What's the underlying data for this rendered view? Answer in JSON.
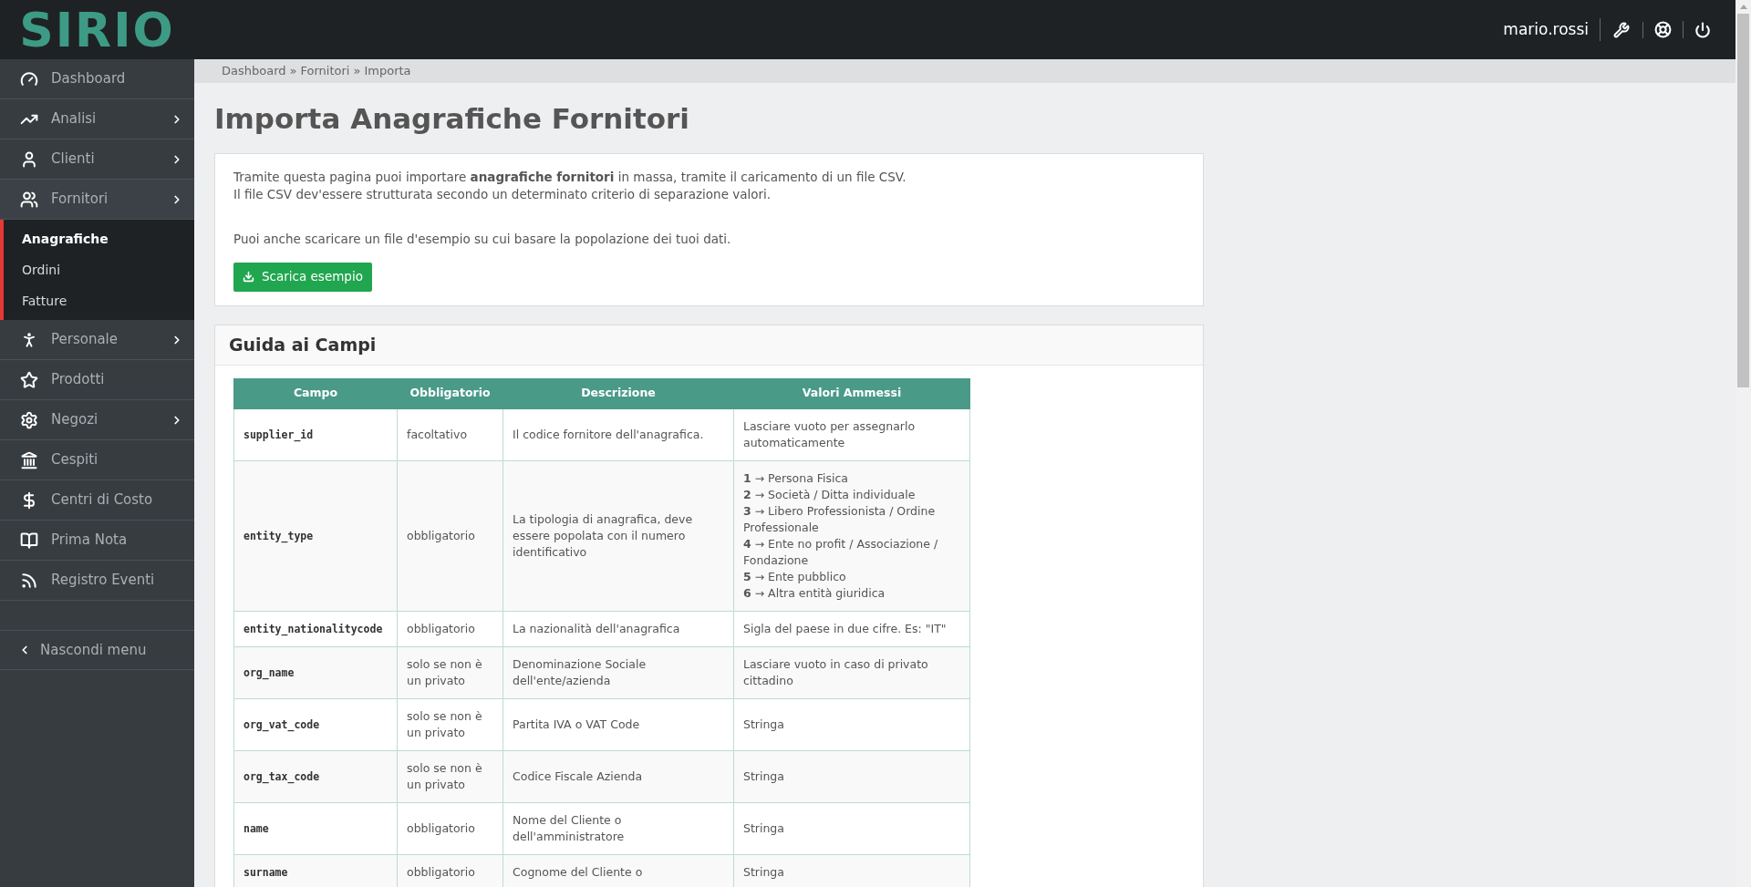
{
  "header": {
    "logo": "SIRIO",
    "username": "mario.rossi"
  },
  "sidebar": {
    "items": [
      {
        "label": "Dashboard",
        "has_submenu": false
      },
      {
        "label": "Analisi",
        "has_submenu": true
      },
      {
        "label": "Clienti",
        "has_submenu": true
      },
      {
        "label": "Fornitori",
        "has_submenu": true,
        "expanded": true,
        "children": [
          {
            "label": "Anagrafiche",
            "selected": true
          },
          {
            "label": "Ordini",
            "selected": false
          },
          {
            "label": "Fatture",
            "selected": false
          }
        ]
      },
      {
        "label": "Personale",
        "has_submenu": true
      },
      {
        "label": "Prodotti",
        "has_submenu": false
      },
      {
        "label": "Negozi",
        "has_submenu": true
      },
      {
        "label": "Cespiti",
        "has_submenu": false
      },
      {
        "label": "Centri di Costo",
        "has_submenu": false
      },
      {
        "label": "Prima Nota",
        "has_submenu": false
      },
      {
        "label": "Registro Eventi",
        "has_submenu": false
      }
    ],
    "collapse_link": "Nascondi menu"
  },
  "breadcrumb": {
    "items": [
      "Dashboard",
      "Fornitori",
      "Importa"
    ],
    "separator": "»"
  },
  "title": "Importa Anagrafiche Fornitori",
  "intro": {
    "lines": [
      "Tramite questa pagina puoi importare **anagrafiche fornitori** in massa, tramite il caricamento di un file CSV.",
      "Il file CSV dev'essere strutturata secondo un determinato criterio di separazione valori."
    ],
    "note": "Puoi anche scaricare un file d'esempio su cui basare la popolazione dei tuoi dati.",
    "button": "Scarica esempio"
  },
  "guide": {
    "title": "Guida ai Campi",
    "table": {
      "columns": [
        "Campo",
        "Obbligatorio",
        "Descrizione",
        "Valori Ammessi"
      ],
      "rows": [
        {
          "field": "supplier_id",
          "required": "facoltativo",
          "description": "Il codice fornitore dell'anagrafica.",
          "values": [
            "Lasciare vuoto per assegnarlo automaticamente"
          ]
        },
        {
          "field": "entity_type",
          "required": "obbligatorio",
          "description": "La tipologia di anagrafica, deve essere popolata con il numero identificativo",
          "values": [
            "**1** → Persona Fisica",
            "**2** → Società / Ditta individuale",
            "**3** → Libero Professionista / Ordine Professionale",
            "**4** → Ente no profit / Associazione / Fondazione",
            "**5** → Ente pubblico",
            "**6** → Altra entità giuridica"
          ]
        },
        {
          "field": "entity_nationalitycode",
          "required": "obbligatorio",
          "description": "La nazionalità dell'anagrafica",
          "values": [
            "Sigla del paese in due cifre. Es: \"IT\""
          ]
        },
        {
          "field": "org_name",
          "required": "solo se non è un privato",
          "description": "Denominazione Sociale dell'ente/azienda",
          "values": [
            "Lasciare vuoto in caso di privato cittadino"
          ]
        },
        {
          "field": "org_vat_code",
          "required": "solo se non è un privato",
          "description": "Partita IVA o VAT Code",
          "values": [
            "Stringa"
          ]
        },
        {
          "field": "org_tax_code",
          "required": "solo se non è un privato",
          "description": "Codice Fiscale Azienda",
          "values": [
            "Stringa"
          ]
        },
        {
          "field": "name",
          "required": "obbligatorio",
          "description": "Nome del Cliente o dell'amministratore",
          "values": [
            "Stringa"
          ]
        },
        {
          "field": "surname",
          "required": "obbligatorio",
          "description": "Cognome del Cliente o",
          "values": [
            "Stringa"
          ]
        }
      ]
    }
  }
}
